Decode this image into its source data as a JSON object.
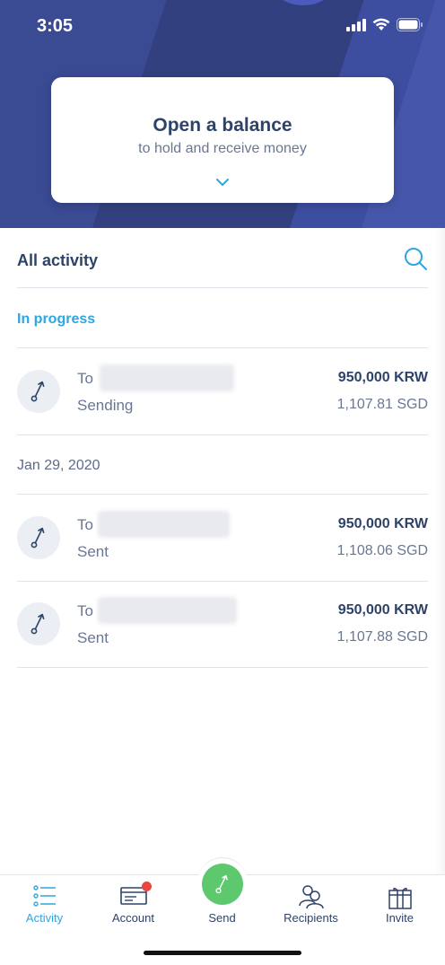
{
  "status_bar": {
    "time": "3:05"
  },
  "balance_card": {
    "title": "Open a balance",
    "subtitle": "to hold and receive money"
  },
  "activity": {
    "title": "All activity",
    "sections": [
      {
        "label": "In progress",
        "transactions": [
          {
            "to_label": "To",
            "status": "Sending",
            "amount": "950,000 KRW",
            "converted": "1,107.81 SGD"
          }
        ]
      },
      {
        "label": "Jan 29, 2020",
        "transactions": [
          {
            "to_label": "To",
            "status": "Sent",
            "amount": "950,000 KRW",
            "converted": "1,108.06 SGD"
          },
          {
            "to_label": "To",
            "status": "Sent",
            "amount": "950,000 KRW",
            "converted": "1,107.88 SGD"
          }
        ]
      }
    ]
  },
  "tabbar": {
    "tabs": [
      {
        "label": "Activity",
        "icon": "activity-list-icon",
        "active": true
      },
      {
        "label": "Account",
        "icon": "account-card-icon",
        "active": false
      },
      {
        "label": "Send",
        "icon": "send-arrow-icon",
        "active": false
      },
      {
        "label": "Recipients",
        "icon": "recipients-icon",
        "active": false
      },
      {
        "label": "Invite",
        "icon": "gift-icon",
        "active": false
      }
    ]
  },
  "colors": {
    "hero_background": "#33407f",
    "accent_blue": "#2ea6e0",
    "send_green": "#5ec86f",
    "notification_red": "#e8463f",
    "text_dark": "#2e4369"
  }
}
